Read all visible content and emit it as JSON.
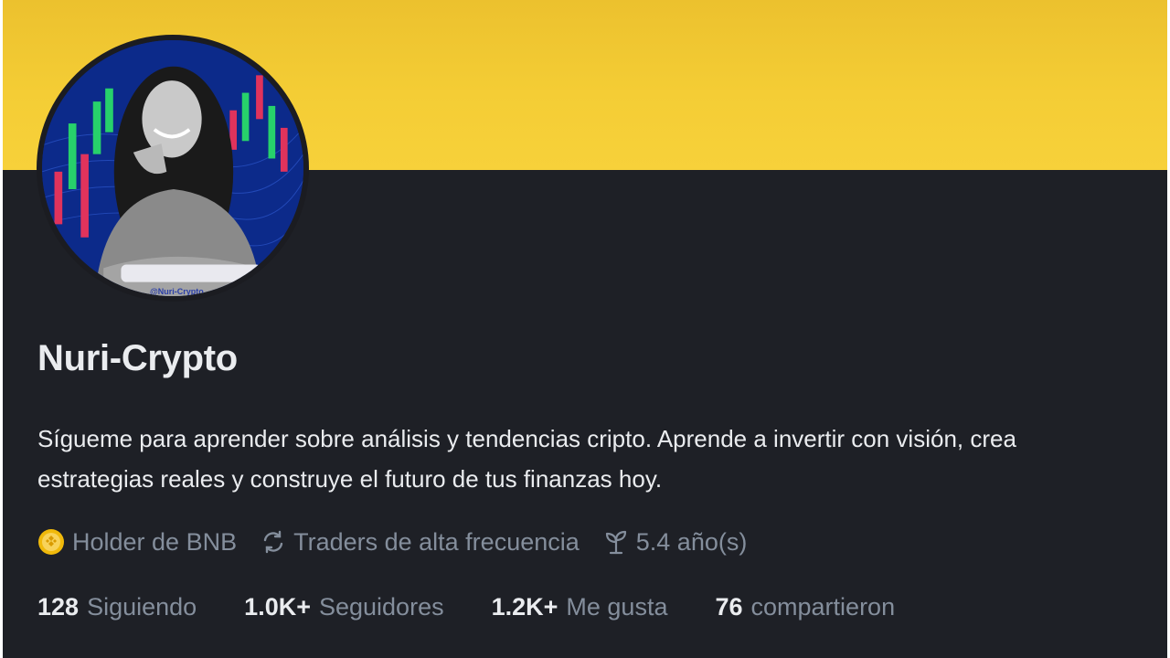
{
  "colors": {
    "banner": "#f4cd35",
    "background": "#1e2026",
    "text_primary": "#eaecef",
    "text_secondary": "#848e9c",
    "badge_gold": "#f0b90b"
  },
  "profile": {
    "avatar_watermark": "@Nuri-Crypto",
    "name": "Nuri-Crypto",
    "bio": "Sígueme para aprender sobre análisis y tendencias cripto. Aprende a invertir con visión, crea estrategias reales y construye el futuro de tus finanzas hoy."
  },
  "tags": [
    {
      "icon": "bnb-coin-icon",
      "label": "Holder de BNB"
    },
    {
      "icon": "refresh-cycle-icon",
      "label": "Traders de alta frecuencia"
    },
    {
      "icon": "sprout-icon",
      "label": "5.4 año(s)"
    }
  ],
  "stats": [
    {
      "value": "128",
      "label": "Siguiendo"
    },
    {
      "value": "1.0K+",
      "label": "Seguidores"
    },
    {
      "value": "1.2K+",
      "label": "Me gusta"
    },
    {
      "value": "76",
      "label": "compartieron"
    }
  ]
}
